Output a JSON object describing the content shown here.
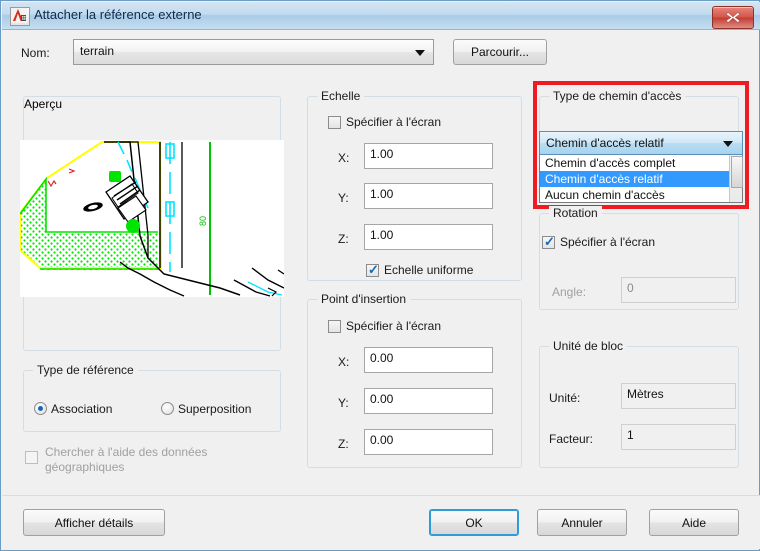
{
  "window": {
    "title": "Attacher la référence externe",
    "icon": "autocad-logo-icon",
    "close_label": "✕",
    "accent_red": "#ee1c22",
    "highlight_blue": "#3399ff",
    "background": "#f0f0f0"
  },
  "name_row": {
    "label": "Nom:",
    "value": "terrain",
    "browse_label": "Parcourir..."
  },
  "preview": {
    "title": "Aperçu",
    "annotation": "80"
  },
  "reference_type": {
    "title": "Type de référence",
    "options": [
      {
        "label": "Association",
        "selected": true
      },
      {
        "label": "Superposition",
        "selected": false
      }
    ],
    "geo_checkbox": {
      "label": "Chercher à l'aide des données géographiques",
      "checked": false,
      "enabled": false
    }
  },
  "scale": {
    "title": "Echelle",
    "specify_on_screen": {
      "label": "Spécifier à l'écran",
      "checked": false
    },
    "fields": [
      {
        "label": "X:",
        "value": "1.00"
      },
      {
        "label": "Y:",
        "value": "1.00"
      },
      {
        "label": "Z:",
        "value": "1.00"
      }
    ],
    "uniform": {
      "label": "Echelle uniforme",
      "checked": true
    }
  },
  "insertion_point": {
    "title": "Point d'insertion",
    "specify_on_screen": {
      "label": "Spécifier à l'écran",
      "checked": false
    },
    "fields": [
      {
        "label": "X:",
        "value": "0.00"
      },
      {
        "label": "Y:",
        "value": "0.00"
      },
      {
        "label": "Z:",
        "value": "0.00"
      }
    ]
  },
  "path_type": {
    "title": "Type de chemin d'accès",
    "selected": "Chemin d'accès relatif",
    "expanded": true,
    "options": [
      {
        "label": "Chemin d'accès complet",
        "selected": false
      },
      {
        "label": "Chemin d'accès relatif",
        "selected": true
      },
      {
        "label": "Aucun chemin d'accès",
        "selected": false
      }
    ]
  },
  "rotation": {
    "title": "Rotation",
    "specify_on_screen": {
      "label": "Spécifier à l'écran",
      "checked": true
    },
    "angle": {
      "label": "Angle:",
      "value": "0",
      "enabled": false
    }
  },
  "block_unit": {
    "title": "Unité de bloc",
    "unit": {
      "label": "Unité:",
      "value": "Mètres"
    },
    "factor": {
      "label": "Facteur:",
      "value": "1"
    }
  },
  "footer": {
    "details_label": "Afficher détails",
    "ok_label": "OK",
    "cancel_label": "Annuler",
    "help_label": "Aide"
  }
}
